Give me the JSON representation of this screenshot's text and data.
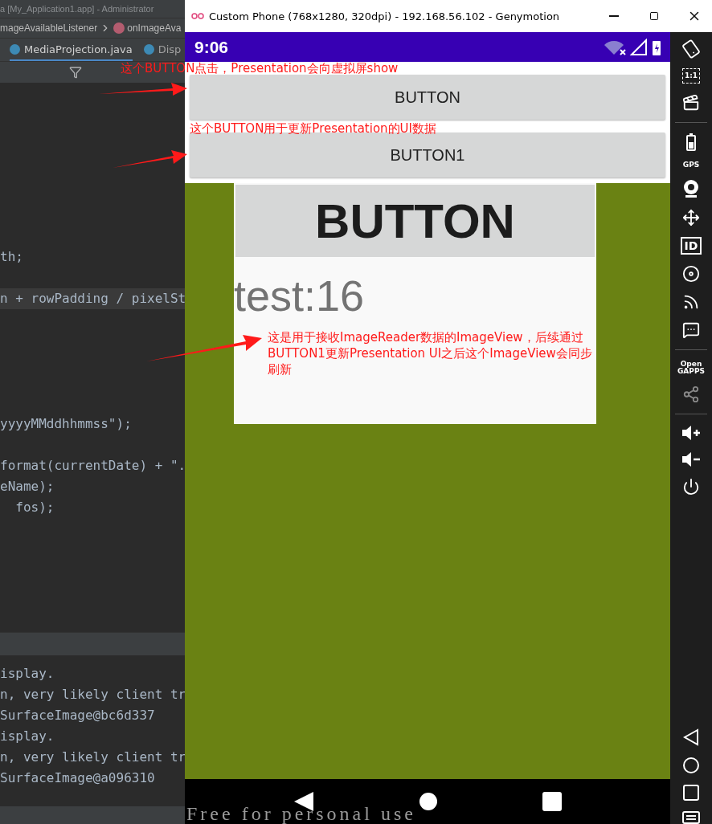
{
  "ide": {
    "title": "a [My_Application1.app] - Administrator",
    "breadcrumb": [
      "mageAvailableListener",
      "onImageAva"
    ],
    "tabs": [
      {
        "label": "MediaProjection.java",
        "selected": true
      },
      {
        "label": "Disp",
        "selected": false
      }
    ],
    "code_lines": [
      {
        "text": "th;",
        "highlighted": false
      },
      {
        "text": "n + rowPadding / pixelSt",
        "highlighted": true
      },
      {
        "text": "yyyyMMddhhmmss\");",
        "highlighted": false
      },
      {
        "text": "format(currentDate) + \".",
        "highlighted": false
      },
      {
        "text": "eName);",
        "highlighted": false
      },
      {
        "text": "  fos);",
        "highlighted": false
      }
    ],
    "log_lines": [
      "isplay.",
      "n, very likely client tr",
      "SurfaceImage@bc6d337",
      "isplay.",
      "n, very likely client tr",
      "SurfaceImage@a096310"
    ]
  },
  "emulator": {
    "title": "Custom Phone (768x1280, 320dpi) - 192.168.56.102 - Genymotion",
    "status_time": "9:06",
    "buttons": [
      "BUTTON",
      "BUTTON1"
    ],
    "presentation": {
      "button": "BUTTON",
      "text": "test:16"
    },
    "toolbar": [
      {
        "kind": "rotate"
      },
      {
        "kind": "scale",
        "label": "1:1"
      },
      {
        "kind": "clapper"
      },
      {
        "kind": "divider"
      },
      {
        "kind": "battery"
      },
      {
        "kind": "gps",
        "label": "GPS"
      },
      {
        "kind": "webcam"
      },
      {
        "kind": "dpad"
      },
      {
        "kind": "id",
        "label": "ID"
      },
      {
        "kind": "disk"
      },
      {
        "kind": "cast"
      },
      {
        "kind": "message"
      },
      {
        "kind": "divider"
      },
      {
        "kind": "gapps",
        "label": "Open",
        "sublabel": "GAPPS"
      },
      {
        "kind": "share"
      },
      {
        "kind": "divider"
      },
      {
        "kind": "volup"
      },
      {
        "kind": "voldown"
      },
      {
        "kind": "power"
      },
      {
        "kind": "spacer"
      },
      {
        "kind": "back"
      },
      {
        "kind": "home"
      },
      {
        "kind": "recents"
      },
      {
        "kind": "menu"
      }
    ],
    "license": "Free for personal use"
  },
  "annotations": [
    "这个BUTTON点击，Presentation会向虚拟屏show",
    "这个BUTTON用于更新Presentation的UI数据",
    "这是用于接收ImageReader数据的ImageView，后续通过BUTTON1更新Presentation UI之后这个ImageView会同步刷新"
  ]
}
